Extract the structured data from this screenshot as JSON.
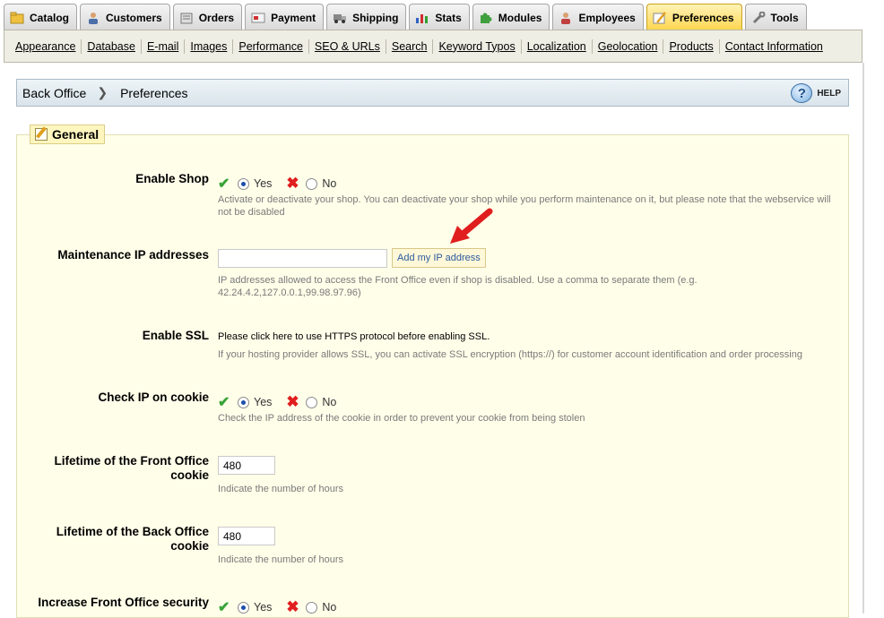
{
  "tabs": [
    {
      "label": "Catalog",
      "icon": "folder-icon"
    },
    {
      "label": "Customers",
      "icon": "customer-icon"
    },
    {
      "label": "Orders",
      "icon": "orders-icon"
    },
    {
      "label": "Payment",
      "icon": "payment-icon"
    },
    {
      "label": "Shipping",
      "icon": "truck-icon"
    },
    {
      "label": "Stats",
      "icon": "chart-icon"
    },
    {
      "label": "Modules",
      "icon": "puzzle-icon"
    },
    {
      "label": "Employees",
      "icon": "employee-icon"
    },
    {
      "label": "Preferences",
      "icon": "preferences-icon"
    },
    {
      "label": "Tools",
      "icon": "wrench-icon"
    }
  ],
  "active_tab": "Preferences",
  "subnav": [
    "Appearance",
    "Database",
    "E-mail",
    "Images",
    "Performance",
    "SEO & URLs",
    "Search",
    "Keyword Typos",
    "Localization",
    "Geolocation",
    "Products",
    "Contact Information"
  ],
  "breadcrumb": {
    "root": "Back Office",
    "current": "Preferences",
    "help": "HELP"
  },
  "section": {
    "legend": "General"
  },
  "fields": {
    "enable_shop": {
      "label": "Enable Shop",
      "yes": "Yes",
      "no": "No",
      "selected": "Yes",
      "hint": "Activate or deactivate your shop. You can deactivate your shop while you perform maintenance on it, but please note that the webservice will not be disabled"
    },
    "maintenance_ip": {
      "label": "Maintenance IP addresses",
      "value": "",
      "button": "Add my IP address",
      "hint": "IP addresses allowed to access the Front Office even if shop is disabled. Use a comma to separate them (e.g. 42.24.4.2,127.0.0.1,99.98.97.96)"
    },
    "enable_ssl": {
      "label": "Enable SSL",
      "text": "Please click here to use HTTPS protocol before enabling SSL.",
      "hint": "If your hosting provider allows SSL, you can activate SSL encryption (https://) for customer account identification and order processing"
    },
    "check_ip_cookie": {
      "label": "Check IP on cookie",
      "yes": "Yes",
      "no": "No",
      "selected": "Yes",
      "hint": "Check the IP address of the cookie in order to prevent your cookie from being stolen"
    },
    "front_cookie": {
      "label_1": "Lifetime of the Front Office",
      "label_2": "cookie",
      "value": "480",
      "hint": "Indicate the number of hours"
    },
    "back_cookie": {
      "label_1": "Lifetime of the Back Office",
      "label_2": "cookie",
      "value": "480",
      "hint": "Indicate the number of hours"
    },
    "front_security": {
      "label": "Increase Front Office security",
      "yes": "Yes",
      "no": "No",
      "selected": "Yes"
    }
  },
  "colors": {
    "active_tab": "#ffd64d",
    "fieldset_bg": "#fffee9",
    "arrow": "#e01e1e"
  }
}
